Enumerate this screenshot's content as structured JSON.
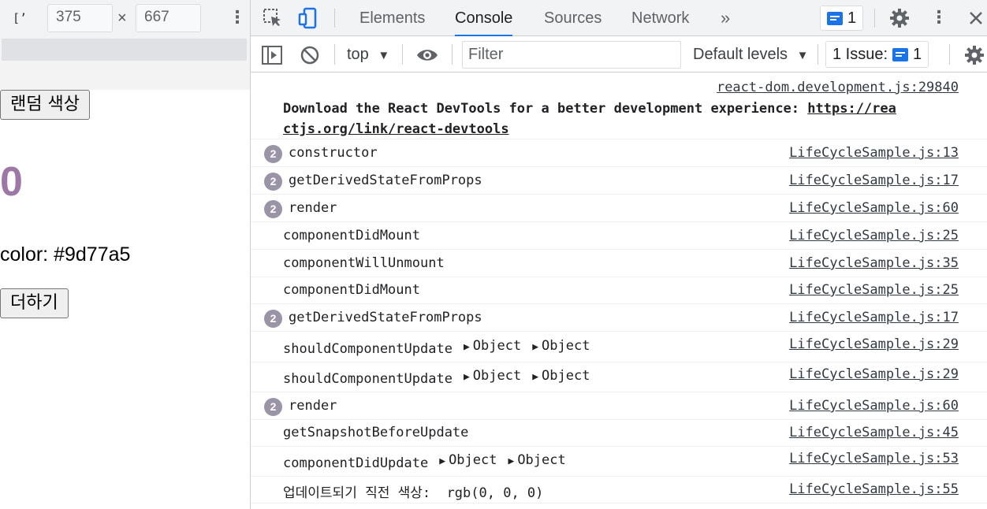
{
  "device_toolbar": {
    "width": "375",
    "height": "667",
    "times": "×"
  },
  "page": {
    "random_color_button": "랜덤 색상",
    "counter": "0",
    "counter_color": "#9d77a5",
    "color_label": "color: #9d77a5",
    "add_button": "더하기"
  },
  "devtools": {
    "tabs": [
      "Elements",
      "Console",
      "Sources",
      "Network"
    ],
    "active_tab": "Console",
    "more_tabs": "»",
    "issue_count_top": "1",
    "context": "top",
    "filter_placeholder": "Filter",
    "levels": "Default levels",
    "issues_label": "1 Issue:",
    "issues_count": "1"
  },
  "console": {
    "intro_source": "react-dom.development.js:29840",
    "intro_text": "Download the React DevTools for a better development experience: ",
    "intro_link_1": "https://rea",
    "intro_link_2": "ctjs.org/link/react-devtools",
    "rows": [
      {
        "count": "2",
        "text": "constructor",
        "source": "LifeCycleSample.js:13"
      },
      {
        "count": "2",
        "text": "getDerivedStateFromProps",
        "source": "LifeCycleSample.js:17"
      },
      {
        "count": "2",
        "text": "render",
        "source": "LifeCycleSample.js:60"
      },
      {
        "count": "",
        "text": "componentDidMount",
        "source": "LifeCycleSample.js:25"
      },
      {
        "count": "",
        "text": "componentWillUnmount",
        "source": "LifeCycleSample.js:35"
      },
      {
        "count": "",
        "text": "componentDidMount",
        "source": "LifeCycleSample.js:25"
      },
      {
        "count": "2",
        "text": "getDerivedStateFromProps",
        "source": "LifeCycleSample.js:17"
      },
      {
        "count": "",
        "text": "shouldComponentUpdate",
        "args": [
          "Object",
          "Object"
        ],
        "source": "LifeCycleSample.js:29"
      },
      {
        "count": "",
        "text": "shouldComponentUpdate",
        "args": [
          "Object",
          "Object"
        ],
        "source": "LifeCycleSample.js:29"
      },
      {
        "count": "2",
        "text": "render",
        "source": "LifeCycleSample.js:60"
      },
      {
        "count": "",
        "text": "getSnapshotBeforeUpdate",
        "source": "LifeCycleSample.js:45"
      },
      {
        "count": "",
        "text": "componentDidUpdate",
        "args": [
          "Object",
          "Object"
        ],
        "source": "LifeCycleSample.js:53"
      },
      {
        "count": "",
        "text": "업데이트되기 직전 색상:  rgb(0, 0, 0)",
        "source": "LifeCycleSample.js:55"
      }
    ]
  },
  "colors": {
    "accent": "#1a73e8",
    "counter": "#9d77a5",
    "repeat_badge": "#9a94a6"
  },
  "icons": [
    "device-toggle-icon",
    "kebab-menu-icon",
    "inspect-element-icon",
    "device-mode-icon",
    "message-icon",
    "settings-gear-icon",
    "close-icon",
    "sidebar-toggle-icon",
    "clear-console-icon",
    "eye-icon",
    "dropdown-arrow-icon",
    "expand-triangle-icon"
  ]
}
